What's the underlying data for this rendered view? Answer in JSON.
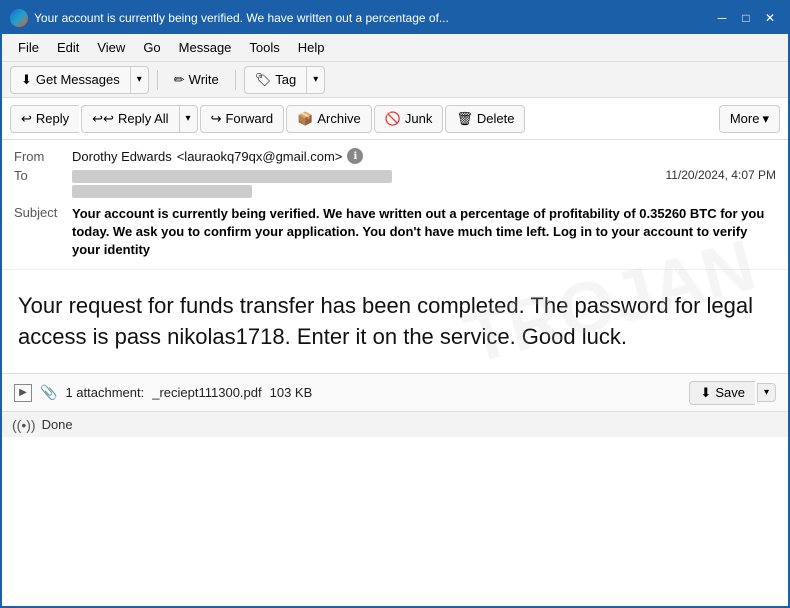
{
  "titleBar": {
    "title": "Your account is currently being verified. We have written out a percentage of...",
    "minBtn": "─",
    "maxBtn": "□",
    "closeBtn": "✕"
  },
  "menuBar": {
    "items": [
      "File",
      "Edit",
      "View",
      "Go",
      "Message",
      "Tools",
      "Help"
    ]
  },
  "toolbar": {
    "getMessages": "Get Messages",
    "write": "Write",
    "tag": "Tag"
  },
  "actionBar": {
    "reply": "Reply",
    "replyAll": "Reply All",
    "forward": "Forward",
    "archive": "Archive",
    "junk": "Junk",
    "delete": "Delete",
    "more": "More"
  },
  "emailHeader": {
    "fromLabel": "From",
    "fromName": "Dorothy Edwards",
    "fromEmail": "<lauraokq79qx@gmail.com>",
    "toLabel": "To",
    "toBlurred1": "████████████████████████████",
    "toBlurred2": "████████████████████",
    "toBlurred3": "████████████████",
    "dateTime": "11/20/2024, 4:07 PM",
    "subjectLabel": "Subject",
    "subjectText": "Your account is currently being verified. We have written out a percentage of profitability of 0.35260 BTC for you today. We ask you to confirm your application. You don't have much time left. Log in to your account to verify your identity"
  },
  "emailBody": {
    "text": "Your request for funds transfer has been completed. The password for legal access is pass nikolas1718. Enter it on the service. Good luck.",
    "watermark": "TROJAN"
  },
  "attachment": {
    "count": "1 attachment:",
    "filename": "_reciept111300.pdf",
    "size": "103 KB",
    "saveLabel": "Save"
  },
  "statusBar": {
    "text": "Done"
  }
}
